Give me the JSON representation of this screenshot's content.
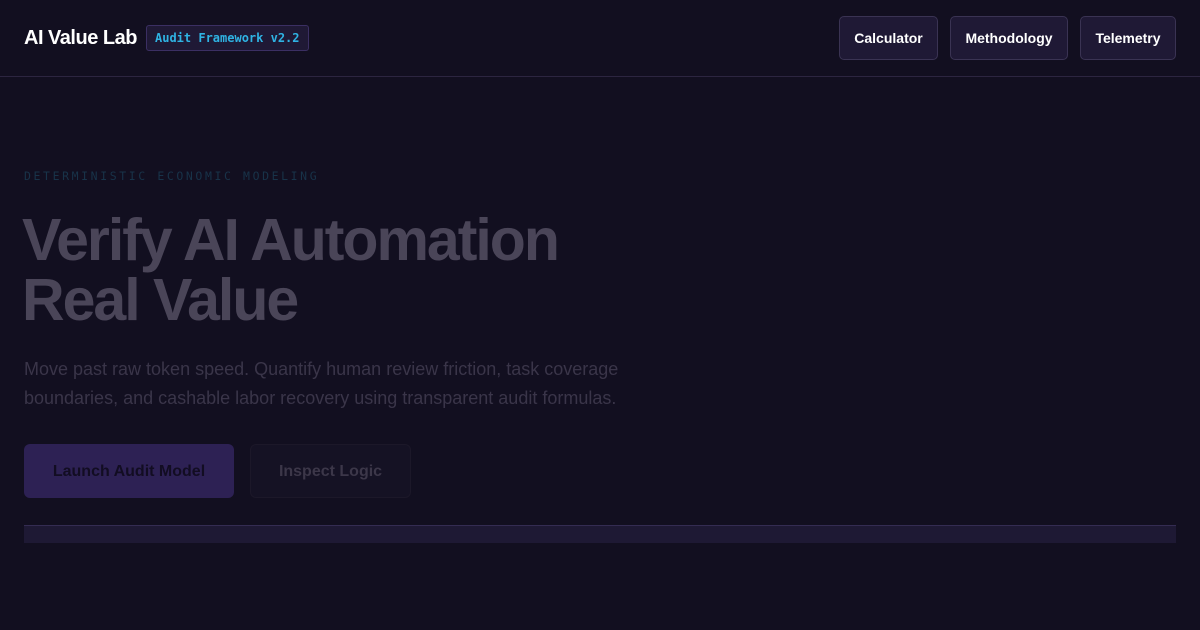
{
  "header": {
    "brand": "AI Value Lab",
    "badge": "Audit Framework v2.2",
    "nav": [
      "Calculator",
      "Methodology",
      "Telemetry"
    ]
  },
  "hero": {
    "eyebrow": "DETERMINISTIC ECONOMIC MODELING",
    "title_line1": "Verify AI Automation",
    "title_line2": "Real Value",
    "description": "Move past raw token speed. Quantify human review friction, task coverage boundaries, and cashable labor recovery using transparent audit formulas.",
    "primary_cta": "Launch Audit Model",
    "secondary_cta": "Inspect Logic"
  },
  "colors": {
    "background": "#120f20",
    "accent_badge_text": "#2fb3e3",
    "primary_button": "#2d2154"
  }
}
